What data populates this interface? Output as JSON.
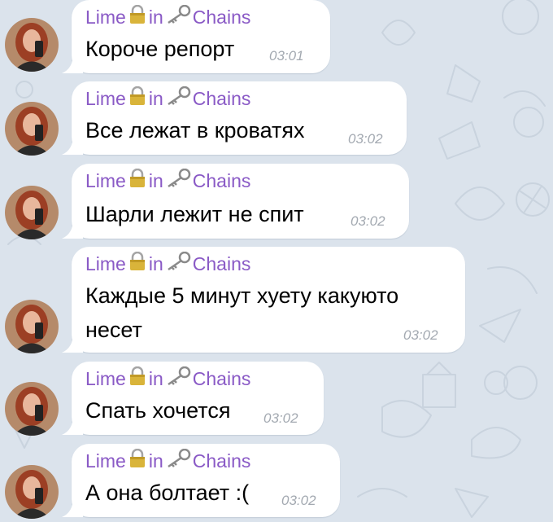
{
  "chat": {
    "accent_color": "#8a5ac6",
    "background_color": "#dbe3ec",
    "bubble_color": "#ffffff",
    "messages": [
      {
        "sender": {
          "name_1": "Lime",
          "icon_1": "lock-emoji",
          "name_2": "in",
          "icon_2": "key-emoji",
          "name_3": "Chains"
        },
        "text": "Короче репорт",
        "time": "03:01"
      },
      {
        "sender": {
          "name_1": "Lime",
          "icon_1": "lock-emoji",
          "name_2": "in",
          "icon_2": "key-emoji",
          "name_3": "Chains"
        },
        "text": "Все лежат в кроватях",
        "time": "03:02"
      },
      {
        "sender": {
          "name_1": "Lime",
          "icon_1": "lock-emoji",
          "name_2": "in",
          "icon_2": "key-emoji",
          "name_3": "Chains"
        },
        "text": "Шарли лежит не спит",
        "time": "03:02"
      },
      {
        "sender": {
          "name_1": "Lime",
          "icon_1": "lock-emoji",
          "name_2": "in",
          "icon_2": "key-emoji",
          "name_3": "Chains"
        },
        "text_line_1": "Каждые 5 минут хуету какуюто",
        "text_line_2": "несет",
        "time": "03:02"
      },
      {
        "sender": {
          "name_1": "Lime",
          "icon_1": "lock-emoji",
          "name_2": "in",
          "icon_2": "key-emoji",
          "name_3": "Chains"
        },
        "text": "Спать хочется",
        "time": "03:02"
      },
      {
        "sender": {
          "name_1": "Lime",
          "icon_1": "lock-emoji",
          "name_2": "in",
          "icon_2": "key-emoji",
          "name_3": "Chains"
        },
        "text": "А она болтает :(",
        "time": "03:02"
      }
    ]
  }
}
